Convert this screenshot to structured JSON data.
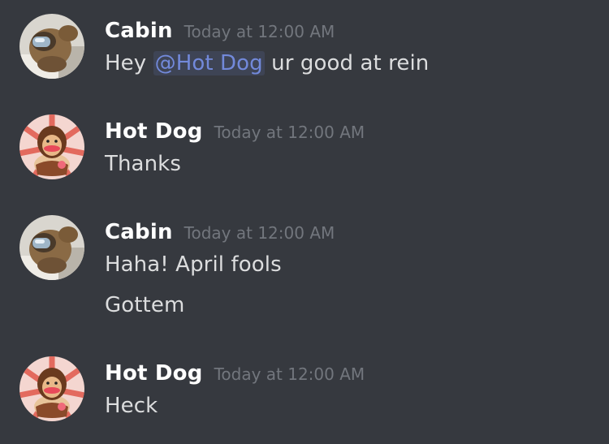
{
  "messages": [
    {
      "author": "Cabin",
      "timestamp": "Today at 12:00 AM",
      "avatar_icon": "pug-crewmate-avatar",
      "lines": [
        {
          "prefix": "Hey ",
          "mention": "@Hot Dog",
          "suffix": " ur good at rein"
        }
      ]
    },
    {
      "author": "Hot Dog",
      "timestamp": "Today at 12:00 AM",
      "avatar_icon": "caveman-avatar",
      "lines": [
        {
          "text": "Thanks"
        }
      ]
    },
    {
      "author": "Cabin",
      "timestamp": "Today at 12:00 AM",
      "avatar_icon": "pug-crewmate-avatar",
      "lines": [
        {
          "text": "Haha! April fools"
        },
        {
          "text": "Gottem"
        }
      ]
    },
    {
      "author": "Hot Dog",
      "timestamp": "Today at 12:00 AM",
      "avatar_icon": "caveman-avatar",
      "lines": [
        {
          "text": "Heck"
        }
      ]
    }
  ],
  "colors": {
    "background": "#36393f",
    "username": "#ffffff",
    "timestamp": "#72767d",
    "text": "#dcddde",
    "mention": "#7289da"
  }
}
